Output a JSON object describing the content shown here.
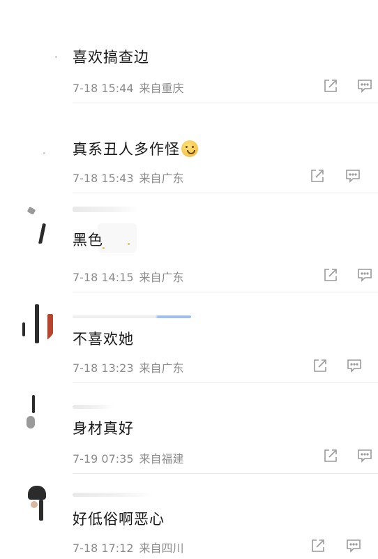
{
  "comments": [
    {
      "text": "喜欢搞查边",
      "time": "7-18 15:44",
      "location": "来自重庆"
    },
    {
      "text": "真系丑人多作怪",
      "time": "7-18 15:43",
      "location": "来自广东"
    },
    {
      "text": "黑色",
      "time": "7-18 14:15",
      "location": "来自广东"
    },
    {
      "text": "不喜欢她",
      "time": "7-18 13:23",
      "location": "来自广东"
    },
    {
      "text": "身材真好",
      "time": "7-19 07:35",
      "location": "来自福建"
    },
    {
      "text": "好低俗啊恶心",
      "time": "7-18 17:12",
      "location": "来自四川"
    }
  ],
  "icons": {
    "share": "share-icon",
    "reply": "comment-icon"
  },
  "colors": {
    "text": "#1a1a1a",
    "meta": "#8c8c8c",
    "icon": "#9a9a9a",
    "divider": "#ececec"
  }
}
